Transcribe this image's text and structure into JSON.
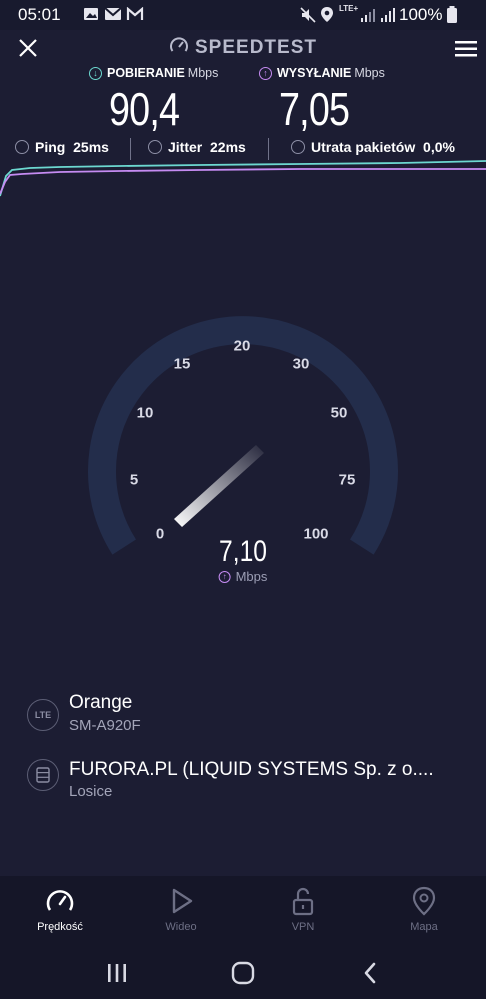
{
  "status_bar": {
    "time": "05:01",
    "network": "LTE+",
    "battery": "100%",
    "icons": [
      "image-icon",
      "mail-icon",
      "gmail-icon",
      "mute-icon",
      "location-icon",
      "signal-icon",
      "battery-icon"
    ]
  },
  "header": {
    "title": "SPEEDTEST",
    "close_icon": "close-icon",
    "menu_icon": "hamburger-menu-icon",
    "logo_icon": "gauge-icon"
  },
  "stats": {
    "download": {
      "label": "POBIERANIE",
      "unit": "Mbps",
      "value": "90,4",
      "color": "#6cd8d0"
    },
    "upload": {
      "label": "WYSYŁANIE",
      "unit": "Mbps",
      "value": "7,05",
      "color": "#c58bf2"
    },
    "ping": {
      "label": "Ping",
      "value": "25ms"
    },
    "jitter": {
      "label": "Jitter",
      "value": "22ms"
    },
    "packet_loss": {
      "label": "Utrata pakietów",
      "value": "0,0%"
    }
  },
  "gauge": {
    "ticks": [
      "0",
      "5",
      "10",
      "15",
      "20",
      "30",
      "50",
      "75",
      "100"
    ],
    "value": "7,10",
    "unit": "Mbps",
    "track_color": "#232d4b"
  },
  "provider": {
    "isp": {
      "name": "Orange",
      "sub": "SM-A920F",
      "badge": "LTE"
    },
    "server": {
      "name": "FURORA.PL (LIQUID SYSTEMS Sp. z o....",
      "sub": "Losice"
    }
  },
  "bottom_nav": {
    "items": [
      {
        "label": "Prędkość",
        "icon": "speedometer-icon",
        "active": true
      },
      {
        "label": "Wideo",
        "icon": "play-icon",
        "active": false
      },
      {
        "label": "VPN",
        "icon": "unlock-icon",
        "active": false
      },
      {
        "label": "Mapa",
        "icon": "map-pin-icon",
        "active": false
      }
    ]
  },
  "system_nav": {
    "icons": [
      "recent-apps-icon",
      "home-icon",
      "back-icon"
    ]
  }
}
